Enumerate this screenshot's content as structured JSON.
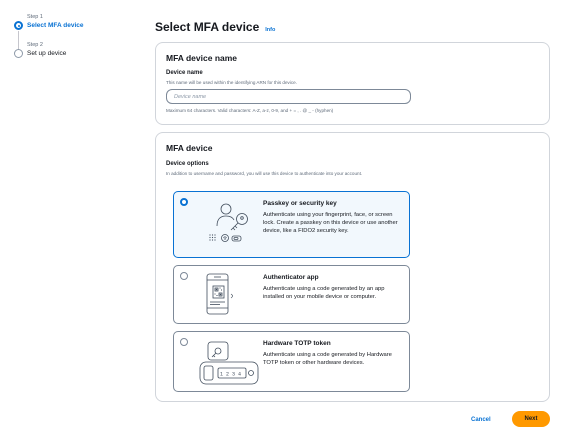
{
  "steps": [
    {
      "number": "Step 1",
      "name": "Select MFA device",
      "active": true
    },
    {
      "number": "Step 2",
      "name": "Set up device",
      "active": false
    }
  ],
  "page": {
    "title": "Select MFA device",
    "info_link": "Info"
  },
  "device_name_section": {
    "heading": "MFA device name",
    "field_label": "Device name",
    "field_description": "This name will be used within the identifying ARN for this device.",
    "input_value": "",
    "input_placeholder": "Device name",
    "constraint_text": "Maximum 64 characters. Valid characters: A-Z, a-z, 0-9, and + = , . @ _ - (hyphen)"
  },
  "device_section": {
    "heading": "MFA device",
    "options_label": "Device options",
    "options_description": "In addition to username and password, you will use this device to authenticate into your account.",
    "options": [
      {
        "title": "Passkey or security key",
        "description": "Authenticate using your fingerprint, face, or screen lock. Create a passkey on this device or use another device, like a FIDO2 security key.",
        "selected": true,
        "icon": "passkey-illustration"
      },
      {
        "title": "Authenticator app",
        "description": "Authenticate using a code generated by an app installed on your mobile device or computer.",
        "selected": false,
        "icon": "authenticator-app-illustration"
      },
      {
        "title": "Hardware TOTP token",
        "description": "Authenticate using a code generated by Hardware TOTP token or other hardware devices.",
        "selected": false,
        "icon": "hardware-token-illustration"
      }
    ]
  },
  "footer": {
    "cancel_label": "Cancel",
    "next_label": "Next"
  },
  "colors": {
    "accent": "#0972d3",
    "primary_button": "#ff9900",
    "selected_tile_bg": "#f2f8fd"
  }
}
